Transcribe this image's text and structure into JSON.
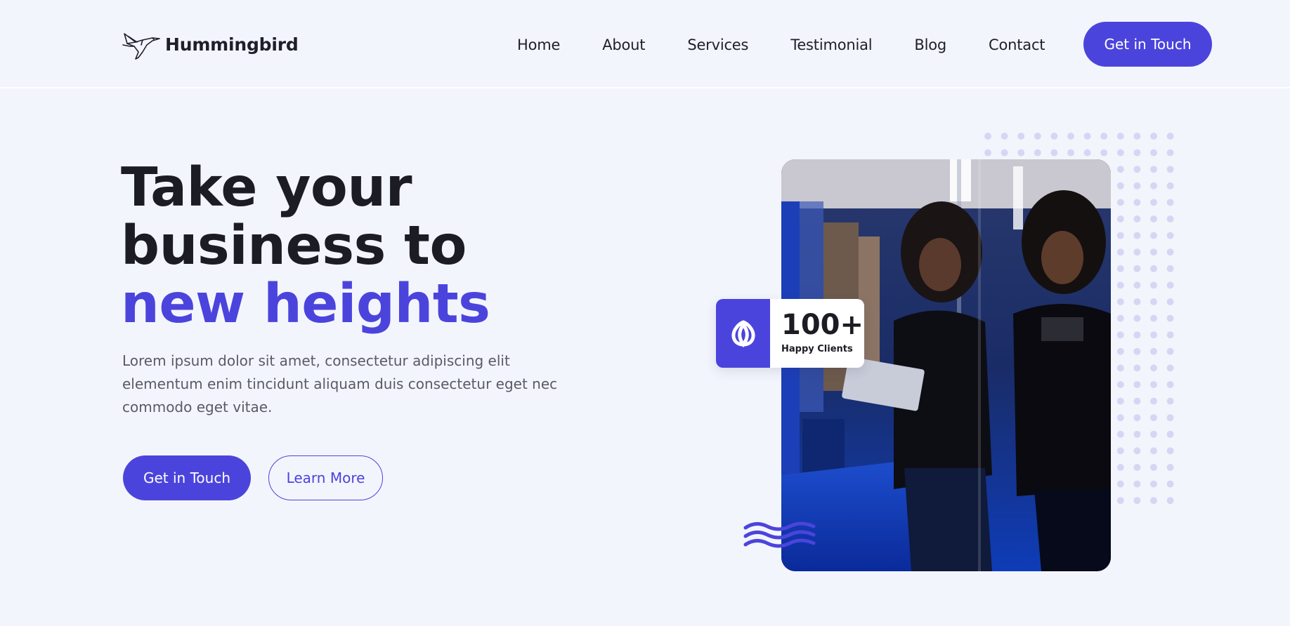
{
  "brand": {
    "name": "Hummingbird",
    "logo_icon": "hummingbird-icon"
  },
  "nav": {
    "items": [
      {
        "label": "Home"
      },
      {
        "label": "About"
      },
      {
        "label": "Services"
      },
      {
        "label": "Testimonial"
      },
      {
        "label": "Blog"
      },
      {
        "label": "Contact"
      }
    ],
    "cta_label": "Get in Touch"
  },
  "hero": {
    "headline_line1": "Take your",
    "headline_line2": "business to",
    "headline_accent": "new heights",
    "description": "Lorem ipsum dolor sit amet, consectetur adipiscing elit elementum enim tincidunt aliquam duis consectetur eget nec commodo eget vitae.",
    "primary_cta": "Get in Touch",
    "secondary_cta": "Learn More"
  },
  "stat": {
    "value": "100+",
    "label": "Happy Clients",
    "icon": "loop-icon"
  },
  "colors": {
    "accent": "#4b44dc",
    "background": "#f3f5fd",
    "heading": "#1c1c24",
    "body_text": "#5a5a66",
    "dot_pattern": "#d6d6f4"
  }
}
